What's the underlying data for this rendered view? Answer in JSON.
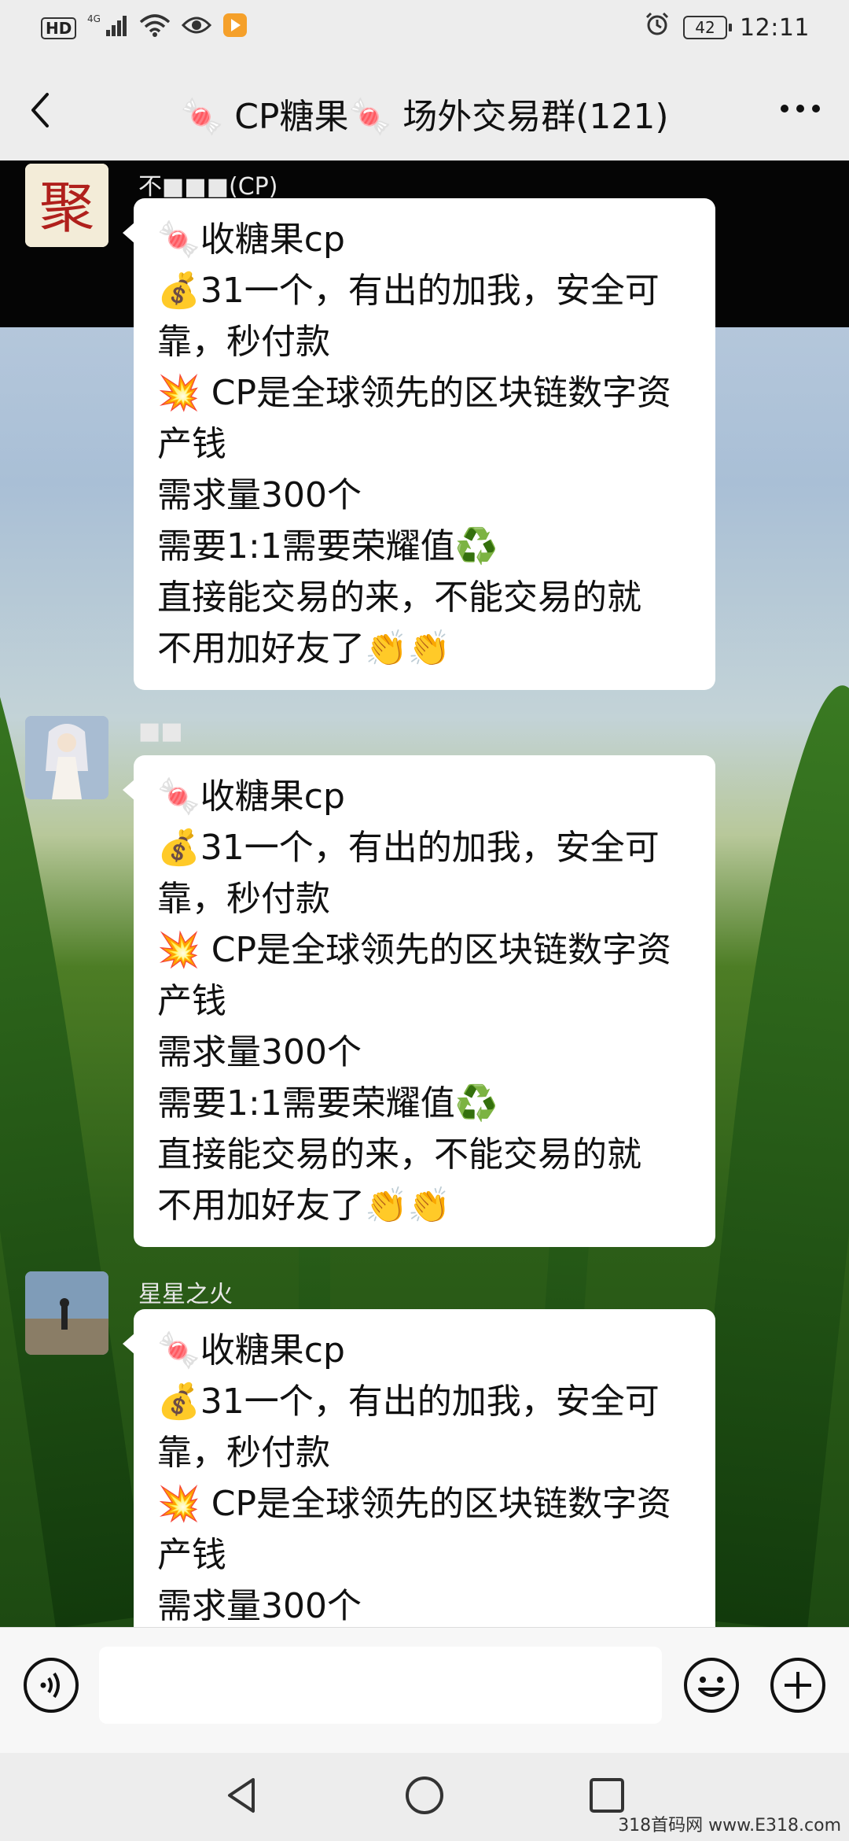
{
  "status_bar": {
    "hd": "HD",
    "network": "4G",
    "battery": "42",
    "time": "12:11"
  },
  "header": {
    "title": "🍬 CP糖果🍬 场外交易群(121)"
  },
  "messages": [
    {
      "sender": "不■■■(CP)",
      "lines": [
        "🍬收糖果cp",
        "💰31一个，有出的加我，安全可",
        "靠，秒付款",
        "💥 CP是全球领先的区块链数字资",
        "产钱",
        "需求量300个",
        "需要1:1需要荣耀值♻️",
        "直接能交易的来，不能交易的就",
        "不用加好友了👏👏"
      ]
    },
    {
      "sender": "■■",
      "lines": [
        "🍬收糖果cp",
        "💰31一个，有出的加我，安全可",
        "靠，秒付款",
        "💥 CP是全球领先的区块链数字资",
        "产钱",
        "需求量300个",
        "需要1:1需要荣耀值♻️",
        "直接能交易的来，不能交易的就",
        "不用加好友了👏👏"
      ]
    },
    {
      "sender": "星星之火",
      "lines": [
        "🍬收糖果cp",
        "💰31一个，有出的加我，安全可",
        "靠，秒付款",
        "💥 CP是全球领先的区块链数字资",
        "产钱",
        "需求量300个"
      ]
    }
  ],
  "input": {
    "placeholder": ""
  },
  "watermark": "318首码网 www.E318.com"
}
